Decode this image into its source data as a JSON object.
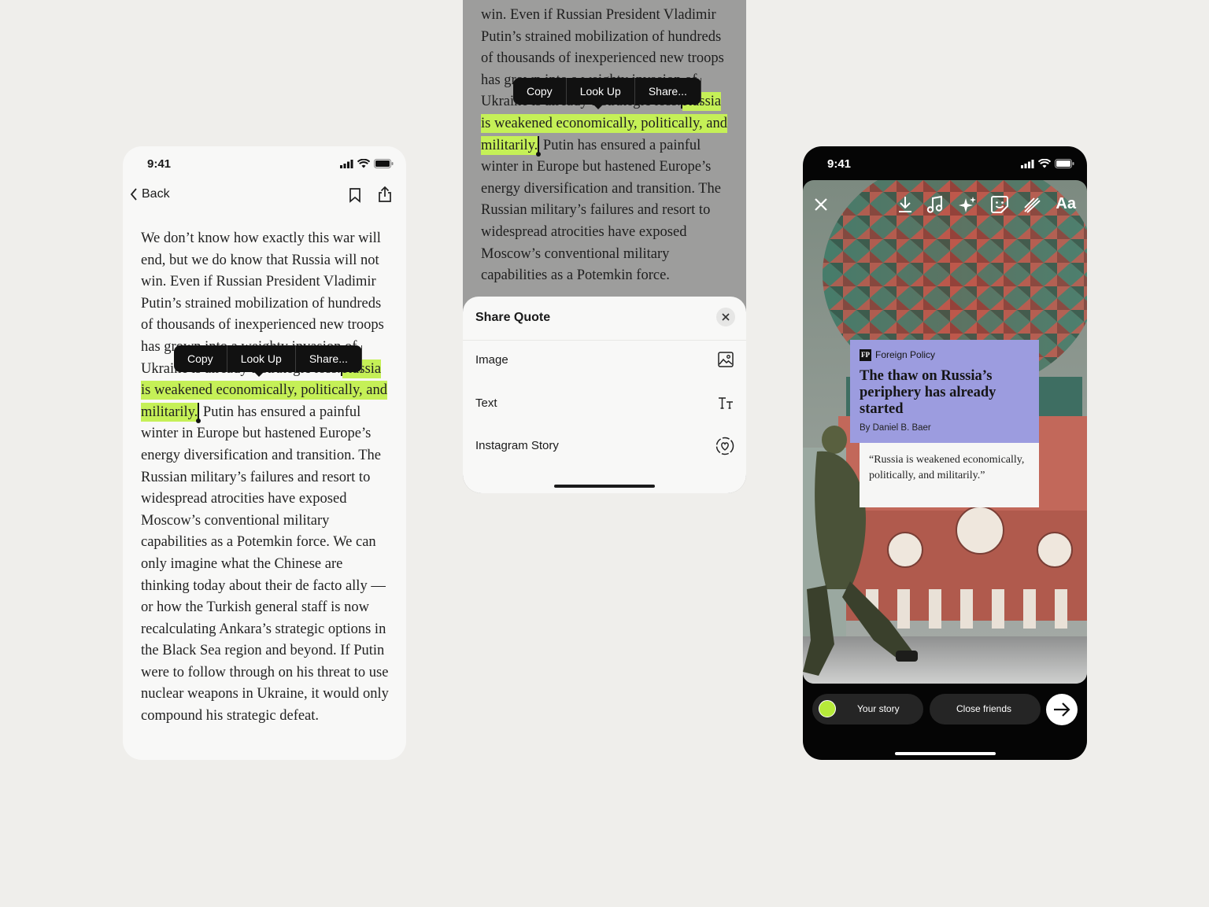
{
  "reader": {
    "status": {
      "time": "9:41"
    },
    "nav": {
      "back_label": "Back"
    },
    "article": {
      "before": "We don’t know how exactly this war will end, but we do know that Russia will not win. Even if Russian President Vladimir Putin’s strained mobilization of hundreds of thousands of inexperienced new troops has grown into a weighty invasion of Ukraine is already a strategic loss.",
      "highlight": "Russia is weakened economically, politically, and militarily.",
      "after": " Putin has ensured a painful winter in Europe but hastened Europe’s energy diversification and transition. The Russian military’s failures and resort to widespread atrocities have exposed Moscow’s conventional military capabilities as a Potemkin force. We can only imagine what the Chinese are thinking today about their de facto ally —or how the Turkish general staff is now recalculating Ankara’s strategic options in the Black Sea region and beyond. If Putin were to follow through on his threat to use nuclear weapons in Ukraine, it would only compound his strategic defeat."
    },
    "context_menu": {
      "copy": "Copy",
      "look_up": "Look Up",
      "share": "Share..."
    }
  },
  "share_view": {
    "article": {
      "before": "win. Even if Russian President Vladimir Putin’s strained mobilization of hundreds of thousands of inexperienced new troops has grown into a weighty invasion of Ukraine is already a strategic loss.",
      "highlight": "Russia is weakened economically, politically, and militarily.",
      "after": " Putin has ensured a painful winter in Europe but hastened Europe’s energy diversification and transition. The Russian military’s failures and resort to widespread atrocities have exposed Moscow’s conventional military capabilities as a Potemkin force."
    },
    "context_menu": {
      "copy": "Copy",
      "look_up": "Look Up",
      "share": "Share..."
    },
    "sheet": {
      "title": "Share Quote",
      "options": [
        {
          "label": "Image",
          "icon": "image-icon"
        },
        {
          "label": "Text",
          "icon": "text-format-icon"
        },
        {
          "label": "Instagram Story",
          "icon": "instagram-story-icon"
        }
      ]
    }
  },
  "story": {
    "status": {
      "time": "9:41"
    },
    "toolbar": {
      "text_tool": "Aa"
    },
    "card": {
      "logo": "FP",
      "publication": "Foreign Policy",
      "title": "The thaw on Russia’s periphery has already started",
      "byline": "By Daniel B. Baer",
      "quote": "“Russia is weakened economically, politically, and militarily.”"
    },
    "bottom": {
      "your_story": "Your story",
      "close_friends": "Close friends"
    },
    "colors": {
      "highlight": "#c5f057",
      "card_header": "#9c9cdf",
      "story_dot": "#b6ea3a"
    }
  }
}
